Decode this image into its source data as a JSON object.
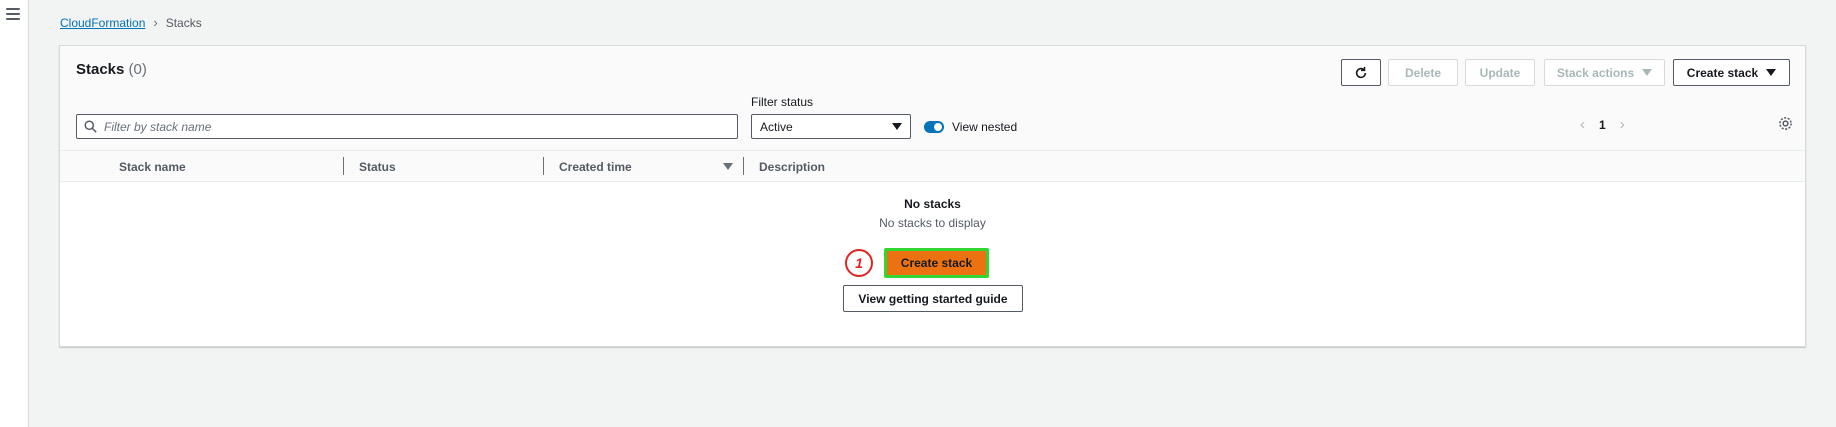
{
  "breadcrumb": {
    "service": "CloudFormation",
    "current": "Stacks"
  },
  "panel": {
    "title": "Stacks",
    "count": "(0)"
  },
  "toolbar": {
    "delete_label": "Delete",
    "update_label": "Update",
    "stack_actions_label": "Stack actions",
    "create_stack_label": "Create stack"
  },
  "search": {
    "placeholder": "Filter by stack name",
    "value": ""
  },
  "filter_status": {
    "label": "Filter status",
    "selected": "Active"
  },
  "view_nested": {
    "label": "View nested",
    "enabled": true
  },
  "pagination": {
    "current_page": "1"
  },
  "table": {
    "columns": [
      "Stack name",
      "Status",
      "Created time",
      "Description"
    ]
  },
  "empty_state": {
    "title": "No stacks",
    "description": "No stacks to display",
    "create_label": "Create stack",
    "guide_label": "View getting started guide",
    "step_marker": "1"
  },
  "colors": {
    "accent": "#0073bb",
    "primary_button": "#ec7211",
    "highlight": "#31d631",
    "marker": "#e02424"
  },
  "icons": [
    "menu-icon",
    "chevron-right-icon",
    "refresh-icon",
    "caret-down-icon",
    "search-icon",
    "chevron-left-icon",
    "gear-icon",
    "sort-descending-icon"
  ]
}
